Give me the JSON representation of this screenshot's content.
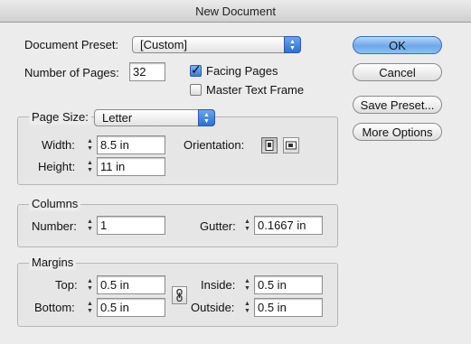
{
  "title": "New Document",
  "preset": {
    "label": "Document Preset:",
    "value": "[Custom]"
  },
  "pages": {
    "label": "Number of Pages:",
    "value": "32"
  },
  "facing_pages": {
    "label": "Facing Pages",
    "checked": true
  },
  "master_text_frame": {
    "label": "Master Text Frame",
    "checked": false
  },
  "page_size": {
    "label": "Page Size:",
    "value": "Letter",
    "width_label": "Width:",
    "width": "8.5 in",
    "height_label": "Height:",
    "height": "11 in",
    "orientation_label": "Orientation:",
    "orientation": "portrait"
  },
  "columns": {
    "title": "Columns",
    "number_label": "Number:",
    "number": "1",
    "gutter_label": "Gutter:",
    "gutter": "0.1667 in"
  },
  "margins": {
    "title": "Margins",
    "top_label": "Top:",
    "top": "0.5 in",
    "bottom_label": "Bottom:",
    "bottom": "0.5 in",
    "inside_label": "Inside:",
    "inside": "0.5 in",
    "outside_label": "Outside:",
    "outside": "0.5 in"
  },
  "buttons": {
    "ok": "OK",
    "cancel": "Cancel",
    "save_preset": "Save Preset...",
    "more_options": "More Options"
  },
  "colors": {
    "accent": "#3d7ad6"
  }
}
